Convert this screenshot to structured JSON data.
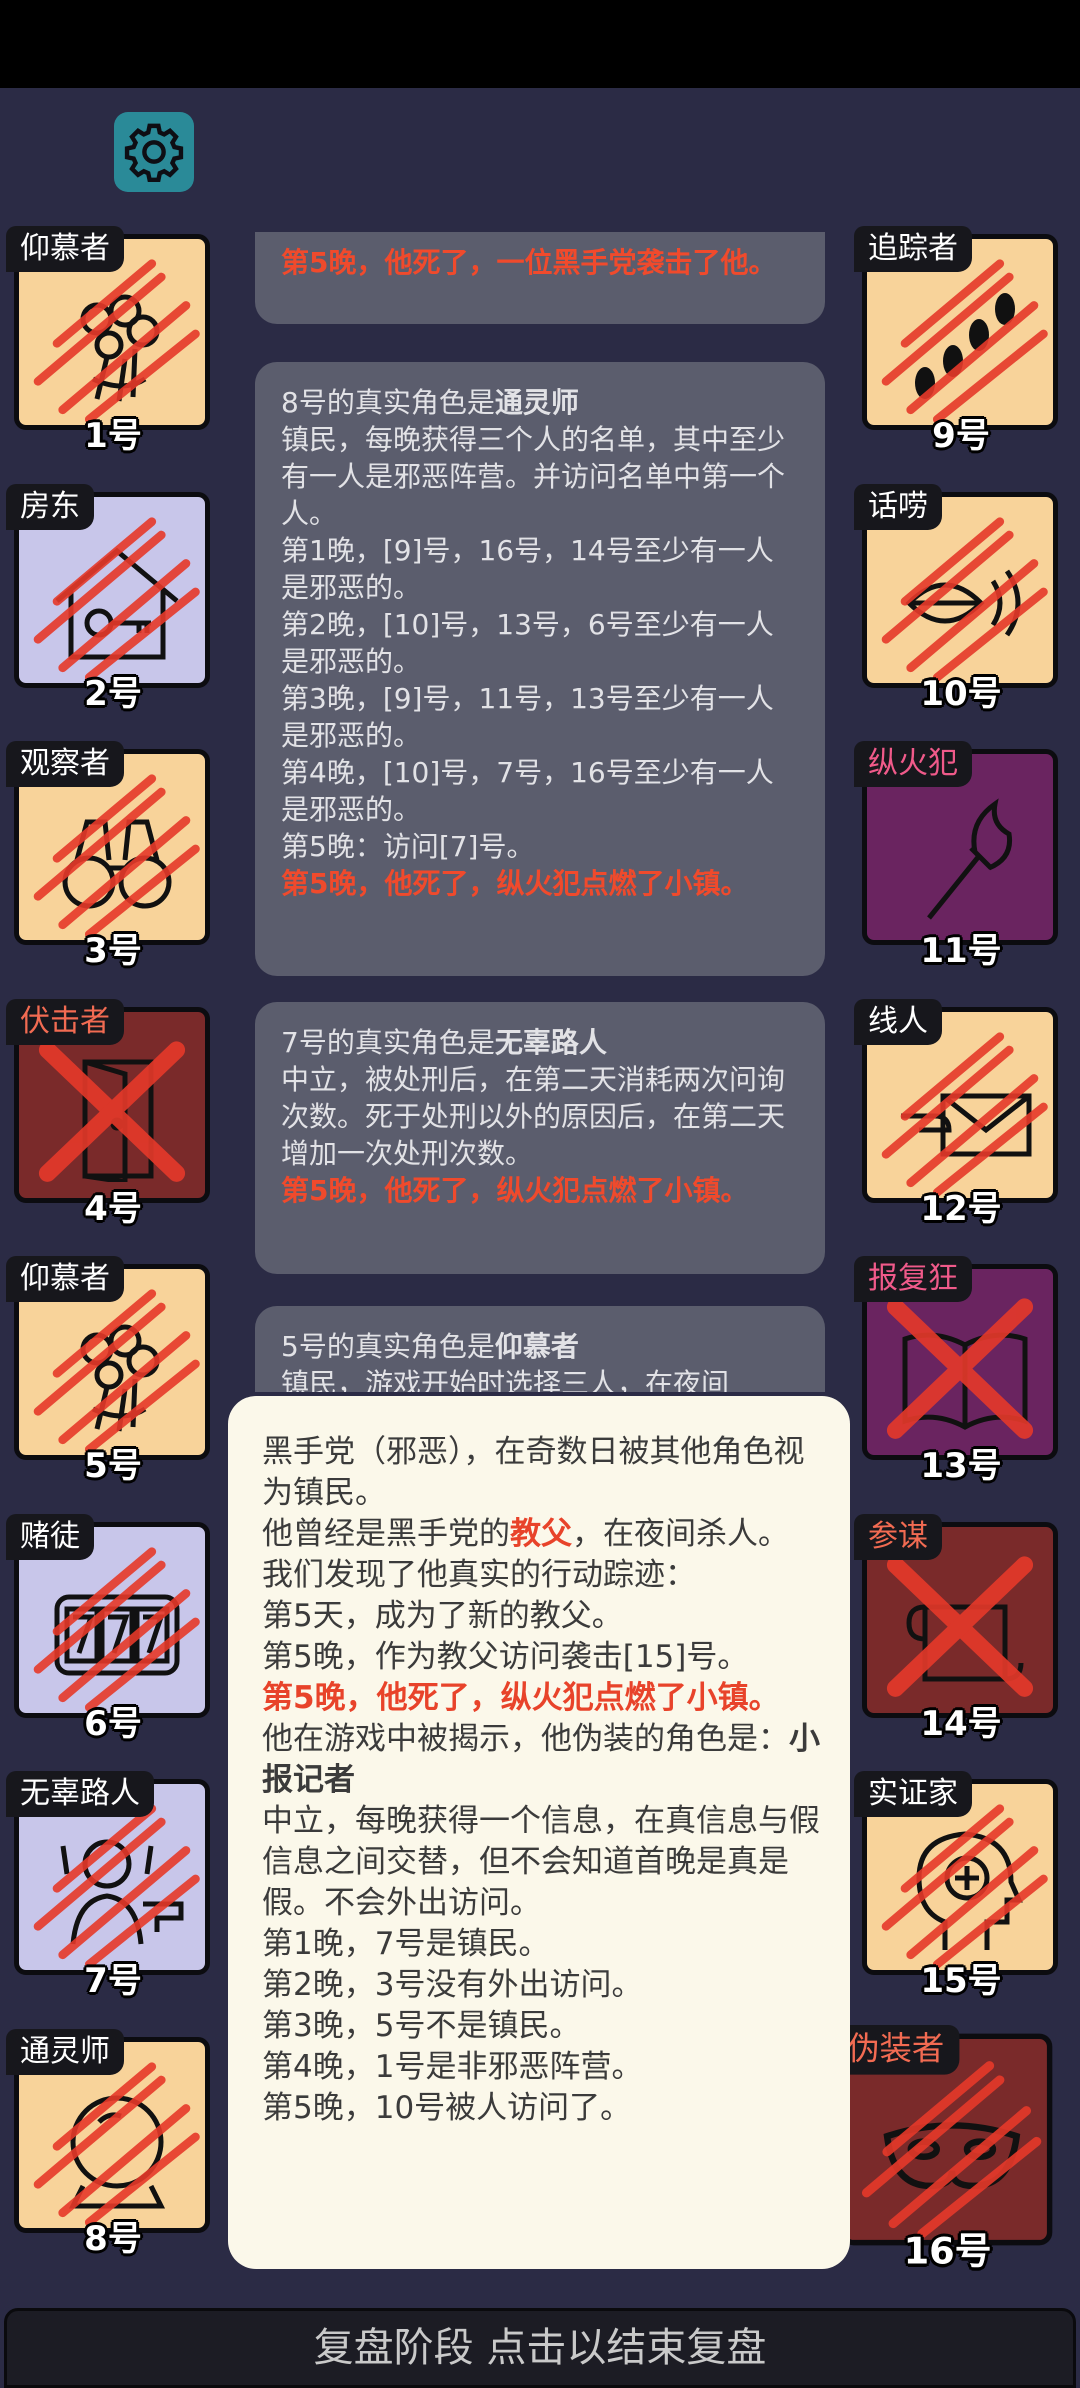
{
  "bottom_bar": "复盘阶段 点击以结束复盘",
  "players_left": [
    {
      "role": "仰慕者",
      "number": "1号",
      "bg": "#f8d39a",
      "icon": "flowers-icon",
      "dead": "claw"
    },
    {
      "role": "房东",
      "number": "2号",
      "bg": "#c8c6ea",
      "icon": "house-key-icon",
      "dead": "claw"
    },
    {
      "role": "观察者",
      "number": "3号",
      "bg": "#f8d39a",
      "icon": "binoculars-icon",
      "dead": "claw"
    },
    {
      "role": "伏击者",
      "number": "4号",
      "bg": "#7a2a2a",
      "icon": "door-icon",
      "dead": "cross",
      "tag_color": "#f26b52"
    },
    {
      "role": "仰慕者",
      "number": "5号",
      "bg": "#f8d39a",
      "icon": "flowers-icon",
      "dead": "claw"
    },
    {
      "role": "赌徒",
      "number": "6号",
      "bg": "#c8c6ea",
      "icon": "slot-777-icon",
      "dead": "claw"
    },
    {
      "role": "无辜路人",
      "number": "7号",
      "bg": "#c8c6ea",
      "icon": "hostage-gun-icon",
      "dead": "claw"
    },
    {
      "role": "通灵师",
      "number": "8号",
      "bg": "#f8d39a",
      "icon": "crystal-ball-icon",
      "dead": "claw"
    }
  ],
  "players_right": [
    {
      "role": "追踪者",
      "number": "9号",
      "bg": "#f8d39a",
      "icon": "footprints-icon",
      "dead": "claw"
    },
    {
      "role": "话唠",
      "number": "10号",
      "bg": "#f8d39a",
      "icon": "mouth-sound-icon",
      "dead": "claw"
    },
    {
      "role": "纵火犯",
      "number": "11号",
      "bg": "#6a2460",
      "icon": "torch-icon",
      "dead": "none",
      "tag_color": "#f05a8a"
    },
    {
      "role": "线人",
      "number": "12号",
      "bg": "#f8d39a",
      "icon": "envelope-hand-icon",
      "dead": "claw"
    },
    {
      "role": "报复狂",
      "number": "13号",
      "bg": "#6a2460",
      "icon": "book-icon",
      "dead": "cross",
      "tag_color": "#f05a8a"
    },
    {
      "role": "参谋",
      "number": "14号",
      "bg": "#7a2a2a",
      "icon": "scroll-icon",
      "dead": "cross",
      "tag_color": "#f26b52"
    },
    {
      "role": "实证家",
      "number": "15号",
      "bg": "#f8d39a",
      "icon": "head-plus-icon",
      "dead": "claw"
    },
    {
      "role": "伪装者",
      "number": "16号",
      "bg": "#7a2a2a",
      "icon": "mask-icon",
      "dead": "claw",
      "tag_color": "#f26b52"
    }
  ],
  "log": {
    "msg0_red": "第5晚，他死了，一位黑手党袭击了他。",
    "msg1_head": "8号的真实角色是",
    "msg1_role": "通灵师",
    "msg1_lines": [
      "镇民，每晚获得三个人的名单，其中至少有一人是邪恶阵营。并访问名单中第一个人。",
      "第1晚，[9]号，16号，14号至少有一人是邪恶的。",
      "第2晚，[10]号，13号，6号至少有一人是邪恶的。",
      "第3晚，[9]号，11号，13号至少有一人是邪恶的。",
      "第4晚，[10]号，7号，16号至少有一人是邪恶的。",
      "第5晚：访问[7]号。"
    ],
    "msg1_red": "第5晚，他死了，纵火犯点燃了小镇。",
    "msg2_head": "7号的真实角色是",
    "msg2_role": "无辜路人",
    "msg2_line": "中立，被处刑后，在第二天消耗两次问询次数。死于处刑以外的原因后，在第二天增加一次处刑次数。",
    "msg2_red": "第5晚，他死了，纵火犯点燃了小镇。",
    "msg3_head": "5号的真实角色是",
    "msg3_role": "仰慕者",
    "msg3_line": "镇民，游戏开始时选择三人，在夜间"
  },
  "popup": {
    "l1": "黑手党（邪恶），在奇数日被其他角色视为镇民。",
    "l2a": "他曾经是黑手党的",
    "l2b": "教父",
    "l2c": "，在夜间杀人。",
    "l3": "我们发现了他真实的行动踪迹：",
    "l4": "第5天，成为了新的教父。",
    "l5": "第5晚，作为教父访问袭击[15]号。",
    "l6": "第5晚，他死了，纵火犯点燃了小镇。",
    "l7a": "他在游戏中被揭示，他伪装的角色是：",
    "l7b": "小报记者",
    "l8": "中立，每晚获得一个信息，在真信息与假信息之间交替，但不会知道首晚是真是假。不会外出访问。",
    "l9": "第1晚，7号是镇民。",
    "l10": "第2晚，3号没有外出访问。",
    "l11": "第3晚，5号不是镇民。",
    "l12": "第4晚，1号是非邪恶阵营。",
    "l13": "第5晚，10号被人访问了。"
  }
}
